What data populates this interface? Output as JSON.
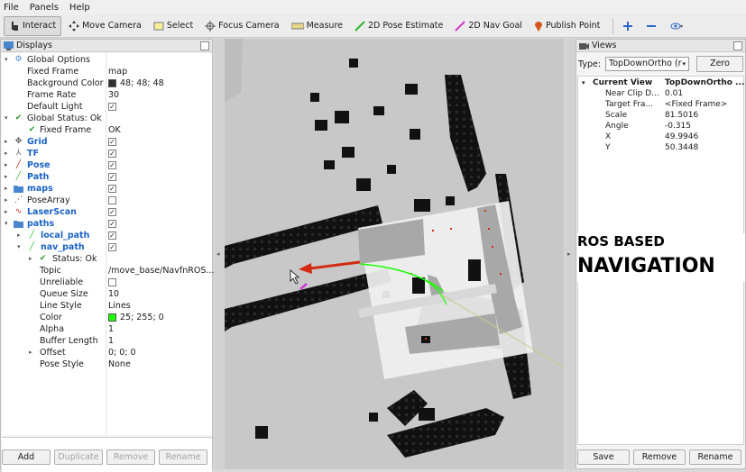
{
  "menu": [
    "File",
    "Panels",
    "Help"
  ],
  "toolbar": {
    "tools": [
      "Interact",
      "Move Camera",
      "Select",
      "Focus Camera",
      "Measure",
      "2D Pose Estimate",
      "2D Nav Goal",
      "Publish Point"
    ]
  },
  "displays_panel": {
    "title": "Displays",
    "rows": [
      {
        "name": "Global Options",
        "value": ""
      },
      {
        "name": "Fixed Frame",
        "value": "map"
      },
      {
        "name": "Background Color",
        "value": "48; 48; 48"
      },
      {
        "name": "Frame Rate",
        "value": "30"
      },
      {
        "name": "Default Light",
        "value": "✓"
      },
      {
        "name": "Global Status: Ok",
        "value": ""
      },
      {
        "name": "Fixed Frame",
        "value": "OK"
      },
      {
        "name": "Grid",
        "value": "✓"
      },
      {
        "name": "TF",
        "value": "✓"
      },
      {
        "name": "Pose",
        "value": "✓"
      },
      {
        "name": "Path",
        "value": "✓"
      },
      {
        "name": "maps",
        "value": "✓"
      },
      {
        "name": "PoseArray",
        "value": ""
      },
      {
        "name": "LaserScan",
        "value": "✓"
      },
      {
        "name": "paths",
        "value": "✓"
      },
      {
        "name": "local_path",
        "value": "✓"
      },
      {
        "name": "nav_path",
        "value": "✓"
      },
      {
        "name": "Status: Ok",
        "value": ""
      },
      {
        "name": "Topic",
        "value": "/move_base/NavfnROS..."
      },
      {
        "name": "Unreliable",
        "value": ""
      },
      {
        "name": "Queue Size",
        "value": "10"
      },
      {
        "name": "Line Style",
        "value": "Lines"
      },
      {
        "name": "Color",
        "value": "25; 255; 0"
      },
      {
        "name": "Alpha",
        "value": "1"
      },
      {
        "name": "Buffer Length",
        "value": "1"
      },
      {
        "name": "Offset",
        "value": "0; 0; 0"
      },
      {
        "name": "Pose Style",
        "value": "None"
      }
    ],
    "buttons": [
      "Add",
      "Duplicate",
      "Remove",
      "Rename"
    ]
  },
  "views_panel": {
    "title": "Views",
    "type_label": "Type:",
    "type_value": "TopDownOrtho (r",
    "zero_label": "Zero",
    "current_view_label": "Current View",
    "current_view_value": "TopDownOrtho ...",
    "rows": [
      {
        "key": "Near Clip D...",
        "value": "0.01"
      },
      {
        "key": "Target Fra...",
        "value": "<Fixed Frame>"
      },
      {
        "key": "Scale",
        "value": "81.5016"
      },
      {
        "key": "Angle",
        "value": "-0.315"
      },
      {
        "key": "X",
        "value": "49.9946"
      },
      {
        "key": "Y",
        "value": "50.3448"
      }
    ],
    "buttons": [
      "Save",
      "Remove",
      "Rename"
    ]
  },
  "overlay": {
    "line1": "ROS BASED",
    "line2": "NAVIGATION"
  },
  "colors": {
    "map_free": "#c8c8c8",
    "map_unknown": "#7b7b7b",
    "obstacle": "#111111",
    "local_map": "#f0f0f0",
    "path": "#19ff00",
    "pose_arrow": "#d42a12",
    "goal": "#d13ad6"
  }
}
